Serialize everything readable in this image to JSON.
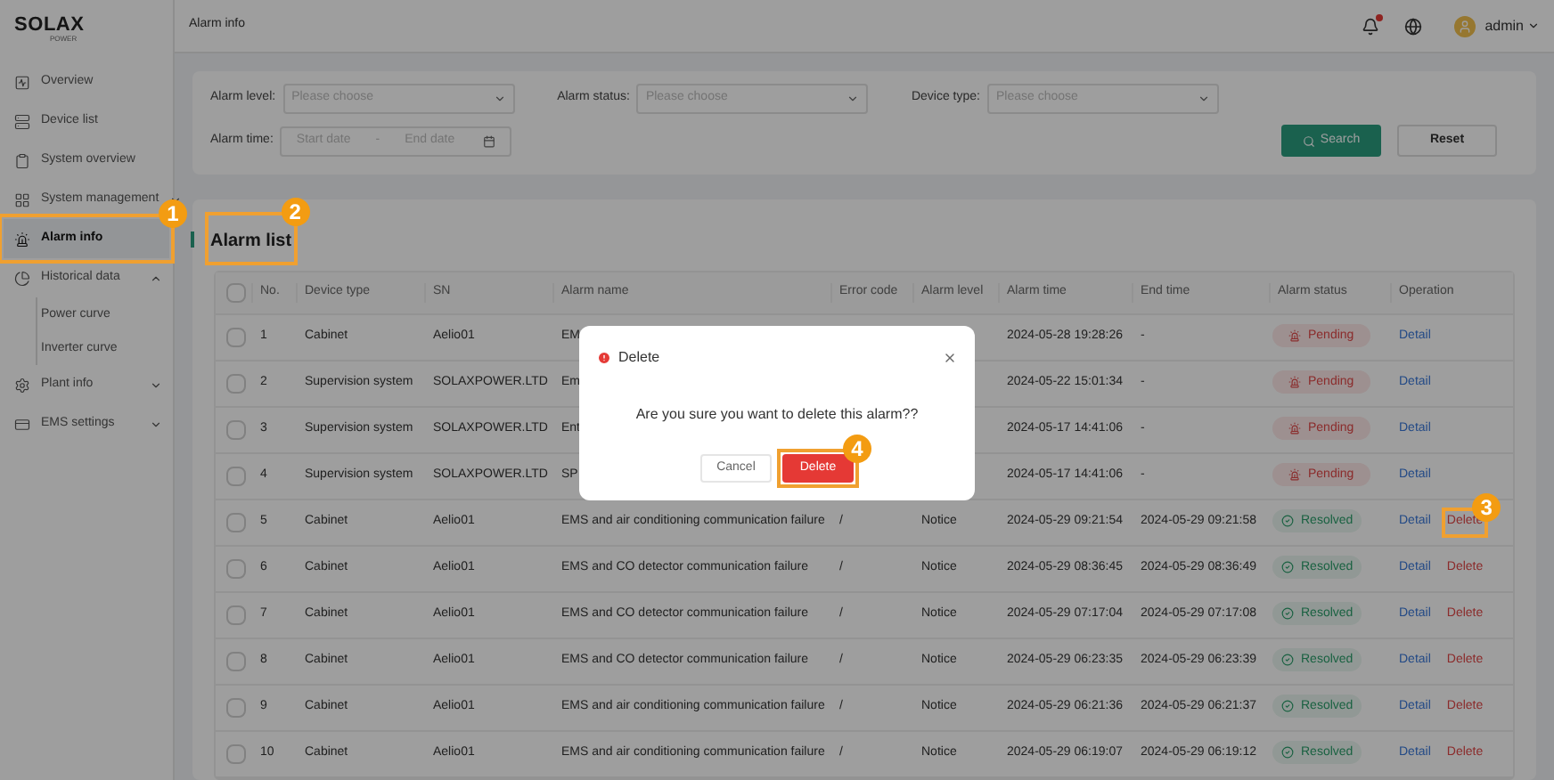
{
  "logo": {
    "brand": "SOLAX",
    "sub": "POWER"
  },
  "sidebar": {
    "items": [
      {
        "label": "Overview",
        "selected": false
      },
      {
        "label": "Device list",
        "selected": false
      },
      {
        "label": "System overview",
        "selected": false
      },
      {
        "label": "System management",
        "selected": false,
        "expanded": false
      },
      {
        "label": "Alarm info",
        "selected": true,
        "callout": "1"
      },
      {
        "label": "Historical data",
        "selected": false,
        "expanded": true,
        "children": [
          {
            "label": "Power curve",
            "selected": false
          },
          {
            "label": "Inverter curve",
            "selected": false
          }
        ]
      },
      {
        "label": "Plant info",
        "selected": false,
        "expanded": false
      },
      {
        "label": "EMS settings",
        "selected": false,
        "expanded": false
      }
    ]
  },
  "top_bar": {
    "breadcrumb": "Alarm info",
    "user": "admin",
    "has_notification": true
  },
  "filters": {
    "fields": [
      {
        "kind": "select",
        "label": "Alarm level:",
        "placeholder": "Please choose"
      },
      {
        "kind": "select",
        "label": "Alarm status:",
        "placeholder": "Please choose"
      },
      {
        "kind": "select",
        "label": "Device type:",
        "placeholder": "Please choose"
      },
      {
        "kind": "daterange",
        "label": "Alarm time:",
        "start_placeholder": "Start date",
        "separator": "-",
        "end_placeholder": "End date"
      }
    ],
    "buttons": [
      {
        "label": "Search",
        "kind": "primary"
      },
      {
        "label": "Reset",
        "kind": "plain"
      }
    ]
  },
  "alarm_list": {
    "title": "Alarm list",
    "callout": "2",
    "columns": [
      "No.",
      "Device type",
      "SN",
      "Alarm name",
      "Error code",
      "Alarm level",
      "Alarm time",
      "End time",
      "Alarm status",
      "Operation"
    ],
    "header_checked": false,
    "rows": [
      {
        "checked": false,
        "no": "1",
        "device_type": "Cabinet",
        "sn": "Aelio01",
        "alarm_name": "EM",
        "alarm_time": "2024-05-28 19:28:26",
        "end_time": "-",
        "status": {
          "kind": "pending",
          "label": "Pending"
        },
        "operations": [
          {
            "kind": "detail",
            "label": "Detail"
          }
        ]
      },
      {
        "checked": false,
        "no": "2",
        "device_type": "Supervision system",
        "sn": "SOLAXPOWER.LTD",
        "alarm_name": "Em",
        "alarm_time": "2024-05-22 15:01:34",
        "end_time": "-",
        "status": {
          "kind": "pending",
          "label": "Pending"
        },
        "operations": [
          {
            "kind": "detail",
            "label": "Detail"
          }
        ]
      },
      {
        "checked": false,
        "no": "3",
        "device_type": "Supervision system",
        "sn": "SOLAXPOWER.LTD",
        "alarm_name": "Ent",
        "alarm_time": "2024-05-17 14:41:06",
        "end_time": "-",
        "status": {
          "kind": "pending",
          "label": "Pending"
        },
        "operations": [
          {
            "kind": "detail",
            "label": "Detail"
          }
        ]
      },
      {
        "checked": false,
        "no": "4",
        "device_type": "Supervision system",
        "sn": "SOLAXPOWER.LTD",
        "alarm_name": "SP",
        "alarm_time": "2024-05-17 14:41:06",
        "end_time": "-",
        "status": {
          "kind": "pending",
          "label": "Pending"
        },
        "operations": [
          {
            "kind": "detail",
            "label": "Detail"
          }
        ]
      },
      {
        "checked": false,
        "no": "5",
        "device_type": "Cabinet",
        "sn": "Aelio01",
        "alarm_name": "EMS and air conditioning communication failure",
        "error_code": "/",
        "alarm_level": "Notice",
        "alarm_time": "2024-05-29 09:21:54",
        "end_time": "2024-05-29 09:21:58",
        "status": {
          "kind": "resolved",
          "label": "Resolved"
        },
        "operations": [
          {
            "kind": "detail",
            "label": "Detail"
          },
          {
            "kind": "delete",
            "label": "Delete",
            "callout": "3"
          }
        ]
      },
      {
        "checked": false,
        "no": "6",
        "device_type": "Cabinet",
        "sn": "Aelio01",
        "alarm_name": "EMS and CO detector communication failure",
        "error_code": "/",
        "alarm_level": "Notice",
        "alarm_time": "2024-05-29 08:36:45",
        "end_time": "2024-05-29 08:36:49",
        "status": {
          "kind": "resolved",
          "label": "Resolved"
        },
        "operations": [
          {
            "kind": "detail",
            "label": "Detail"
          },
          {
            "kind": "delete",
            "label": "Delete"
          }
        ]
      },
      {
        "checked": false,
        "no": "7",
        "device_type": "Cabinet",
        "sn": "Aelio01",
        "alarm_name": "EMS and CO detector communication failure",
        "error_code": "/",
        "alarm_level": "Notice",
        "alarm_time": "2024-05-29 07:17:04",
        "end_time": "2024-05-29 07:17:08",
        "status": {
          "kind": "resolved",
          "label": "Resolved"
        },
        "operations": [
          {
            "kind": "detail",
            "label": "Detail"
          },
          {
            "kind": "delete",
            "label": "Delete"
          }
        ]
      },
      {
        "checked": false,
        "no": "8",
        "device_type": "Cabinet",
        "sn": "Aelio01",
        "alarm_name": "EMS and CO detector communication failure",
        "error_code": "/",
        "alarm_level": "Notice",
        "alarm_time": "2024-05-29 06:23:35",
        "end_time": "2024-05-29 06:23:39",
        "status": {
          "kind": "resolved",
          "label": "Resolved"
        },
        "operations": [
          {
            "kind": "detail",
            "label": "Detail"
          },
          {
            "kind": "delete",
            "label": "Delete"
          }
        ]
      },
      {
        "checked": false,
        "no": "9",
        "device_type": "Cabinet",
        "sn": "Aelio01",
        "alarm_name": "EMS and air conditioning communication failure",
        "error_code": "/",
        "alarm_level": "Notice",
        "alarm_time": "2024-05-29 06:21:36",
        "end_time": "2024-05-29 06:21:37",
        "status": {
          "kind": "resolved",
          "label": "Resolved"
        },
        "operations": [
          {
            "kind": "detail",
            "label": "Detail"
          },
          {
            "kind": "delete",
            "label": "Delete"
          }
        ]
      },
      {
        "checked": false,
        "no": "10",
        "device_type": "Cabinet",
        "sn": "Aelio01",
        "alarm_name": "EMS and air conditioning communication failure",
        "error_code": "/",
        "alarm_level": "Notice",
        "alarm_time": "2024-05-29 06:19:07",
        "end_time": "2024-05-29 06:19:12",
        "status": {
          "kind": "resolved",
          "label": "Resolved"
        },
        "operations": [
          {
            "kind": "detail",
            "label": "Detail"
          },
          {
            "kind": "delete",
            "label": "Delete"
          }
        ]
      }
    ]
  },
  "dialog": {
    "title": "Delete",
    "message": "Are you sure you want to delete this alarm??",
    "buttons": [
      {
        "label": "Cancel",
        "kind": "plain"
      },
      {
        "label": "Delete",
        "kind": "danger",
        "callout": "4"
      }
    ]
  }
}
